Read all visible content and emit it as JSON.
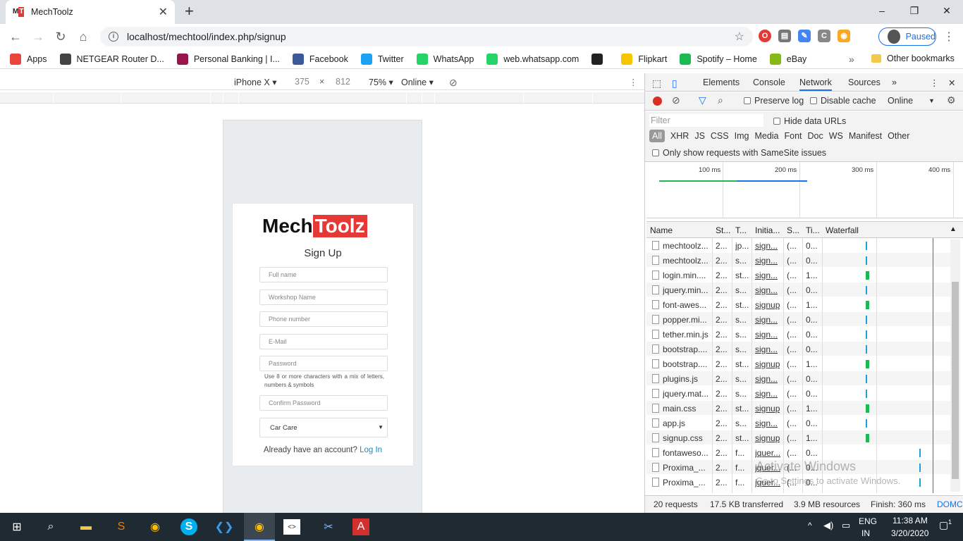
{
  "browser": {
    "tab_title": "MechToolz",
    "url": "localhost/mechtool/index.php/signup",
    "profile_label": "Paused",
    "window_controls": [
      "–",
      "❐",
      "✕"
    ]
  },
  "bookmarks": {
    "items": [
      {
        "label": "Apps",
        "icon": "apps-grid-icon",
        "color": "#e8453c"
      },
      {
        "label": "NETGEAR Router D...",
        "icon": "globe-icon",
        "color": "#444444"
      },
      {
        "label": "Personal Banking | I...",
        "icon": "axis-bank-icon",
        "color": "#97144d"
      },
      {
        "label": "Facebook",
        "icon": "facebook-icon",
        "color": "#3b5998"
      },
      {
        "label": "Twitter",
        "icon": "twitter-icon",
        "color": "#1da1f2"
      },
      {
        "label": "WhatsApp",
        "icon": "whatsapp-icon",
        "color": "#25d366"
      },
      {
        "label": "web.whatsapp.com",
        "icon": "whatsapp-icon",
        "color": "#25d366"
      },
      {
        "label": "",
        "icon": "amazon-icon",
        "color": "#222222"
      },
      {
        "label": "Flipkart",
        "icon": "flipkart-icon",
        "color": "#f7c500"
      },
      {
        "label": "Spotify – Home",
        "icon": "spotify-icon",
        "color": "#1db954"
      },
      {
        "label": "eBay",
        "icon": "ebay-icon",
        "color": "#86b817"
      }
    ],
    "more": "»",
    "other": "Other bookmarks"
  },
  "device_toolbar": {
    "device": "iPhone X ▾",
    "width": "375",
    "times": "×",
    "height": "812",
    "zoom": "75% ▾",
    "network": "Online ▾"
  },
  "signup": {
    "logo_part1": "Mech",
    "logo_part2": "Toolz",
    "title": "Sign Up",
    "fields": {
      "full_name": "Full name",
      "workshop": "Workshop Name",
      "phone": "Phone number",
      "email": "E-Mail",
      "password": "Password",
      "confirm": "Confirm Password"
    },
    "password_hint": "Use 8 or more characters with a mix of letters, numbers & symbols",
    "category_selected": "Car Care",
    "have_account": "Already have an account?",
    "login_link": "Log In"
  },
  "devtools": {
    "tabs": [
      "Elements",
      "Console",
      "Network",
      "Sources",
      "»"
    ],
    "active_tab": "Network",
    "preserve_log": "Preserve log",
    "disable_cache": "Disable cache",
    "throttle": "Online",
    "filter_placeholder": "Filter",
    "hide_data_urls": "Hide data URLs",
    "types": [
      "All",
      "XHR",
      "JS",
      "CSS",
      "Img",
      "Media",
      "Font",
      "Doc",
      "WS",
      "Manifest",
      "Other"
    ],
    "samesite": "Only show requests with SameSite issues",
    "timeline_labels": [
      "100 ms",
      "200 ms",
      "300 ms",
      "400 ms"
    ],
    "columns": [
      "Name",
      "St...",
      "T...",
      "Initia...",
      "S...",
      "Ti...",
      "Waterfall"
    ],
    "rows": [
      {
        "name": "mechtoolz...",
        "status": "2...",
        "type": "jp...",
        "initiator": "sign...",
        "size": "(...",
        "time": "0..."
      },
      {
        "name": "mechtoolz...",
        "status": "2...",
        "type": "s...",
        "initiator": "sign...",
        "size": "(...",
        "time": "0..."
      },
      {
        "name": "login.min....",
        "status": "2...",
        "type": "st...",
        "initiator": "sign...",
        "size": "(...",
        "time": "1..."
      },
      {
        "name": "jquery.min...",
        "status": "2...",
        "type": "s...",
        "initiator": "sign...",
        "size": "(...",
        "time": "0..."
      },
      {
        "name": "font-awes...",
        "status": "2...",
        "type": "st...",
        "initiator": "signup",
        "size": "(...",
        "time": "1..."
      },
      {
        "name": "popper.mi...",
        "status": "2...",
        "type": "s...",
        "initiator": "sign...",
        "size": "(...",
        "time": "0..."
      },
      {
        "name": "tether.min.js",
        "status": "2...",
        "type": "s...",
        "initiator": "sign...",
        "size": "(...",
        "time": "0..."
      },
      {
        "name": "bootstrap....",
        "status": "2...",
        "type": "s...",
        "initiator": "sign...",
        "size": "(...",
        "time": "0..."
      },
      {
        "name": "bootstrap....",
        "status": "2...",
        "type": "st...",
        "initiator": "signup",
        "size": "(...",
        "time": "1..."
      },
      {
        "name": "plugins.js",
        "status": "2...",
        "type": "s...",
        "initiator": "sign...",
        "size": "(...",
        "time": "0..."
      },
      {
        "name": "jquery.mat...",
        "status": "2...",
        "type": "s...",
        "initiator": "sign...",
        "size": "(...",
        "time": "0..."
      },
      {
        "name": "main.css",
        "status": "2...",
        "type": "st...",
        "initiator": "signup",
        "size": "(...",
        "time": "1..."
      },
      {
        "name": "app.js",
        "status": "2...",
        "type": "s...",
        "initiator": "sign...",
        "size": "(...",
        "time": "0..."
      },
      {
        "name": "signup.css",
        "status": "2...",
        "type": "st...",
        "initiator": "signup",
        "size": "(...",
        "time": "1..."
      },
      {
        "name": "fontaweso...",
        "status": "2...",
        "type": "f...",
        "initiator": "jquer...",
        "size": "(...",
        "time": "0..."
      },
      {
        "name": "Proxima_...",
        "status": "2...",
        "type": "f...",
        "initiator": "jquer...",
        "size": "(...",
        "time": "0..."
      },
      {
        "name": "Proxima_...",
        "status": "2...",
        "type": "f...",
        "initiator": "jquer...",
        "size": "(...",
        "time": "0..."
      }
    ],
    "status_bar": {
      "requests": "20 requests",
      "transferred": "17.5 KB transferred",
      "resources": "3.9 MB resources",
      "finish": "Finish: 360 ms",
      "domc": "DOMC"
    }
  },
  "watermark": {
    "line1": "Activate Windows",
    "line2": "Go to Settings to activate Windows."
  },
  "taskbar": {
    "lang": "ENG",
    "region": "IN",
    "time": "11:38 AM",
    "date": "3/20/2020",
    "notifications": "1"
  }
}
